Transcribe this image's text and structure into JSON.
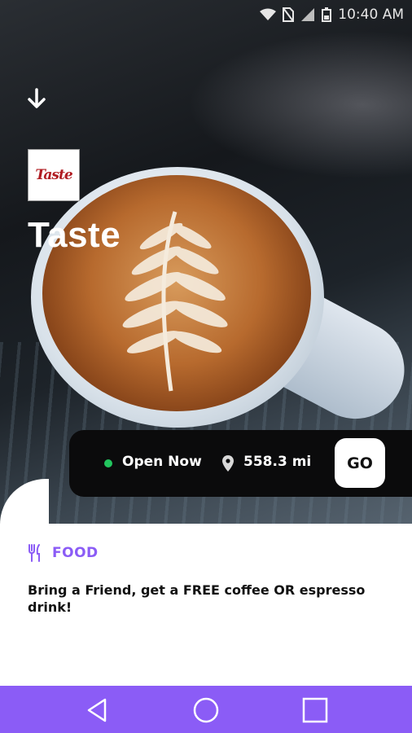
{
  "status_bar": {
    "time": "10:40 AM",
    "icons": [
      "wifi-icon",
      "no-sim-icon",
      "signal-icon",
      "battery-icon"
    ]
  },
  "header": {
    "back_icon": "arrow-down-icon"
  },
  "place": {
    "logo_text": "Taste",
    "name": "Taste"
  },
  "info": {
    "status": "Open Now",
    "status_color": "#22c55e",
    "distance": "558.3 mi",
    "go_label": "GO"
  },
  "details": {
    "category_icon": "fork-knife-icon",
    "category": "FOOD",
    "category_color": "#8b5cf6",
    "description": "Bring a Friend, get a FREE coffee OR espresso drink!"
  },
  "nav": {
    "color": "#8b5cf6",
    "buttons": [
      "back-triangle-icon",
      "home-circle-icon",
      "recents-square-icon"
    ]
  }
}
